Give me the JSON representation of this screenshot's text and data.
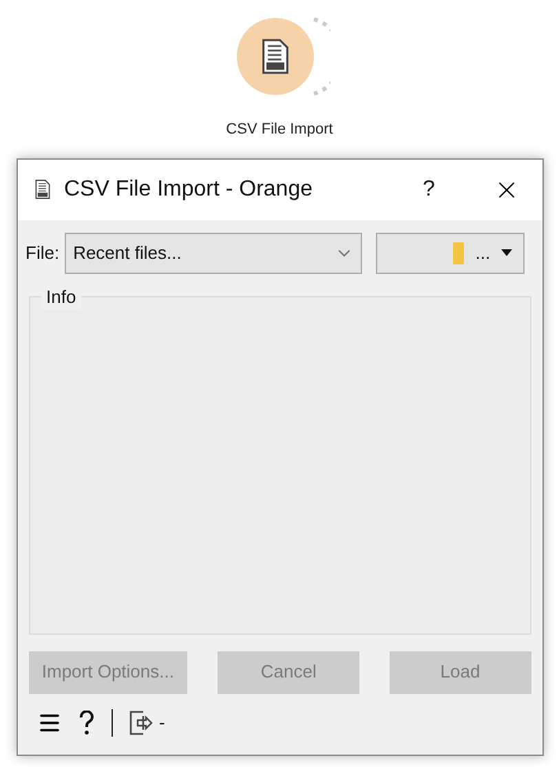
{
  "node": {
    "label": "CSV File Import"
  },
  "window": {
    "title": "CSV File Import - Orange",
    "help": "?"
  },
  "file": {
    "label": "File:",
    "value": "Recent files...",
    "browse": "..."
  },
  "info": {
    "title": "Info"
  },
  "buttons": [
    {
      "label": "Import Options...",
      "disabled": true
    },
    {
      "label": "Cancel",
      "disabled": true
    },
    {
      "label": "Load",
      "disabled": true
    }
  ],
  "status": {
    "output": "-"
  }
}
